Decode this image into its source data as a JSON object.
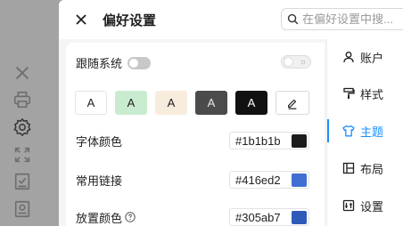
{
  "header": {
    "title": "偏好设置",
    "search_placeholder": "在偏好设置中搜..."
  },
  "left_toolbar": {
    "icons": [
      "close-icon",
      "print-icon",
      "gear-icon",
      "expand-icon",
      "checklist-icon",
      "document-icon"
    ]
  },
  "settings": {
    "follow_system_label": "跟随系统",
    "follow_system_on": false,
    "theme_swatches": [
      {
        "text": "A",
        "bg": "#ffffff",
        "fg": "#1f1f1f",
        "border": "#e5e5e5"
      },
      {
        "text": "A",
        "bg": "#c9ecd0",
        "fg": "#1f1f1f",
        "border": "#c9ecd0"
      },
      {
        "text": "A",
        "bg": "#f8ecdd",
        "fg": "#1f1f1f",
        "border": "#f8ecdd"
      },
      {
        "text": "A",
        "bg": "#4b4b4b",
        "fg": "#e8e8e8",
        "border": "#4b4b4b"
      },
      {
        "text": "A",
        "bg": "#111111",
        "fg": "#ffffff",
        "border": "#111111"
      }
    ],
    "custom_swatch_icon": "pen-icon",
    "fields": [
      {
        "label": "字体颜色",
        "value": "#1b1b1b",
        "color": "#1b1b1b",
        "help": false
      },
      {
        "label": "常用链接",
        "value": "#416ed2",
        "color": "#416ed2",
        "help": false
      },
      {
        "label": "放置颜色",
        "value": "#305ab7",
        "color": "#305ab7",
        "help": true
      }
    ]
  },
  "nav": {
    "items": [
      {
        "label": "账户",
        "icon": "user-icon",
        "active": false
      },
      {
        "label": "样式",
        "icon": "paint-roller-icon",
        "active": false
      },
      {
        "label": "主题",
        "icon": "shirt-icon",
        "active": true
      },
      {
        "label": "布局",
        "icon": "layout-icon",
        "active": false
      },
      {
        "label": "设置",
        "icon": "settings-icon",
        "active": false
      }
    ],
    "accent": "#1890ff"
  }
}
